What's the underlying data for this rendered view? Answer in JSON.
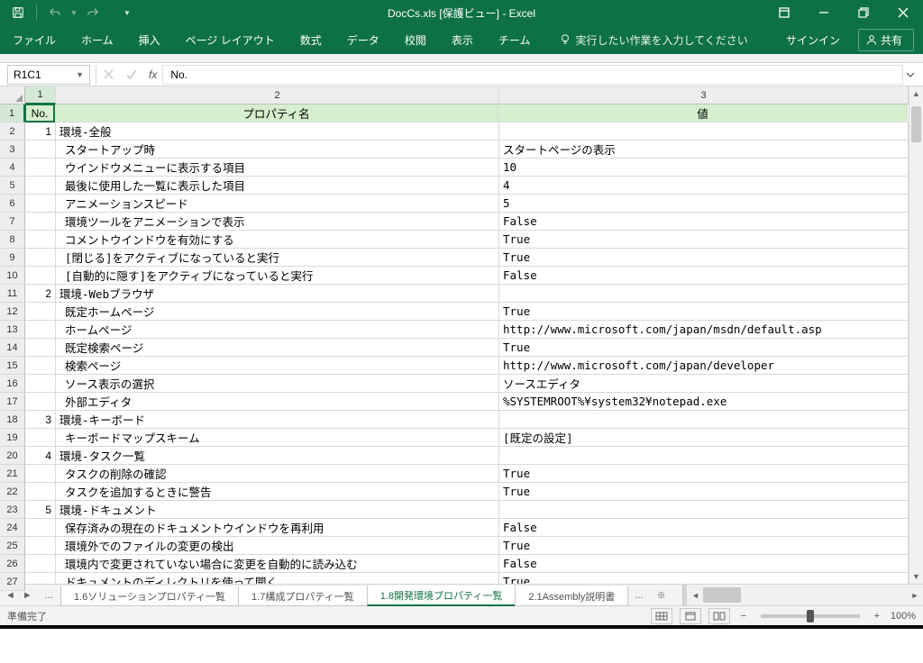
{
  "title": "DocCs.xls  [保護ビュー] - Excel",
  "qat": {
    "save": "保存",
    "undo": "元に戻す",
    "redo": "やり直し"
  },
  "winControls": {
    "restoreSmall": true
  },
  "ribbon": {
    "tabs": [
      "ファイル",
      "ホーム",
      "挿入",
      "ページ レイアウト",
      "数式",
      "データ",
      "校閲",
      "表示",
      "チーム"
    ],
    "tellMe": "実行したい作業を入力してください",
    "signIn": "サインイン",
    "share": "共有"
  },
  "formulaBar": {
    "nameBox": "R1C1",
    "value": "No."
  },
  "columns": [
    "1",
    "2",
    "3"
  ],
  "headerRow": {
    "no": "No.",
    "prop": "プロパティ名",
    "val": "値"
  },
  "rows": [
    {
      "n": "1",
      "no": "1",
      "prop": "環境-全般",
      "val": ""
    },
    {
      "n": "2",
      "no": "",
      "prop": "スタートアップ時",
      "val": "スタートページの表示"
    },
    {
      "n": "3",
      "no": "",
      "prop": "ウインドウメニューに表示する項目",
      "val": "10"
    },
    {
      "n": "4",
      "no": "",
      "prop": "最後に使用した一覧に表示した項目",
      "val": "4"
    },
    {
      "n": "5",
      "no": "",
      "prop": "アニメーションスピード",
      "val": "5"
    },
    {
      "n": "6",
      "no": "",
      "prop": "環境ツールをアニメーションで表示",
      "val": "False"
    },
    {
      "n": "7",
      "no": "",
      "prop": "コメントウインドウを有効にする",
      "val": "True"
    },
    {
      "n": "8",
      "no": "",
      "prop": "[閉じる]をアクティブになっていると実行",
      "val": "True"
    },
    {
      "n": "9",
      "no": "",
      "prop": "[自動的に隠す]をアクティブになっていると実行",
      "val": "False"
    },
    {
      "n": "10",
      "no": "2",
      "prop": "環境-Webブラウザ",
      "val": ""
    },
    {
      "n": "11",
      "no": "",
      "prop": "既定ホームページ",
      "val": "True"
    },
    {
      "n": "12",
      "no": "",
      "prop": "ホームページ",
      "val": "http://www.microsoft.com/japan/msdn/default.asp"
    },
    {
      "n": "13",
      "no": "",
      "prop": "既定検索ページ",
      "val": "True"
    },
    {
      "n": "14",
      "no": "",
      "prop": "検索ページ",
      "val": "http://www.microsoft.com/japan/developer"
    },
    {
      "n": "15",
      "no": "",
      "prop": "ソース表示の選択",
      "val": "ソースエディタ"
    },
    {
      "n": "16",
      "no": "",
      "prop": "外部エディタ",
      "val": "%SYSTEMROOT%¥system32¥notepad.exe"
    },
    {
      "n": "17",
      "no": "3",
      "prop": "環境-キーボード",
      "val": ""
    },
    {
      "n": "18",
      "no": "",
      "prop": "キーボードマップスキーム",
      "val": "[既定の設定]"
    },
    {
      "n": "19",
      "no": "4",
      "prop": "環境-タスク一覧",
      "val": ""
    },
    {
      "n": "20",
      "no": "",
      "prop": "タスクの削除の確認",
      "val": "True"
    },
    {
      "n": "21",
      "no": "",
      "prop": "タスクを追加するときに警告",
      "val": "True"
    },
    {
      "n": "22",
      "no": "5",
      "prop": "環境-ドキュメント",
      "val": ""
    },
    {
      "n": "23",
      "no": "",
      "prop": "保存済みの現在のドキュメントウインドウを再利用",
      "val": "False"
    },
    {
      "n": "24",
      "no": "",
      "prop": "環境外でのファイルの変更の検出",
      "val": "True"
    },
    {
      "n": "25",
      "no": "",
      "prop": "環境内で変更されていない場合に変更を自動的に読み込む",
      "val": "False"
    },
    {
      "n": "26",
      "no": "",
      "prop": "ドキュメントのディレクトリを使って開く",
      "val": "True"
    }
  ],
  "rowNumbers": [
    "1",
    "2",
    "3",
    "4",
    "5",
    "6",
    "7",
    "8",
    "9",
    "10",
    "11",
    "12",
    "13",
    "14",
    "15",
    "16",
    "17",
    "18",
    "19",
    "20",
    "21",
    "22",
    "23",
    "24",
    "25",
    "26",
    "27"
  ],
  "sheetTabs": {
    "before": "...",
    "tabs": [
      "1.6ソリューションプロパティ一覧",
      "1.7構成プロパティ一覧",
      "1.8開発環境プロパティ一覧",
      "2.1Assembly説明書"
    ],
    "active": 2,
    "after": "..."
  },
  "statusBar": {
    "ready": "準備完了",
    "zoom": "100%"
  }
}
